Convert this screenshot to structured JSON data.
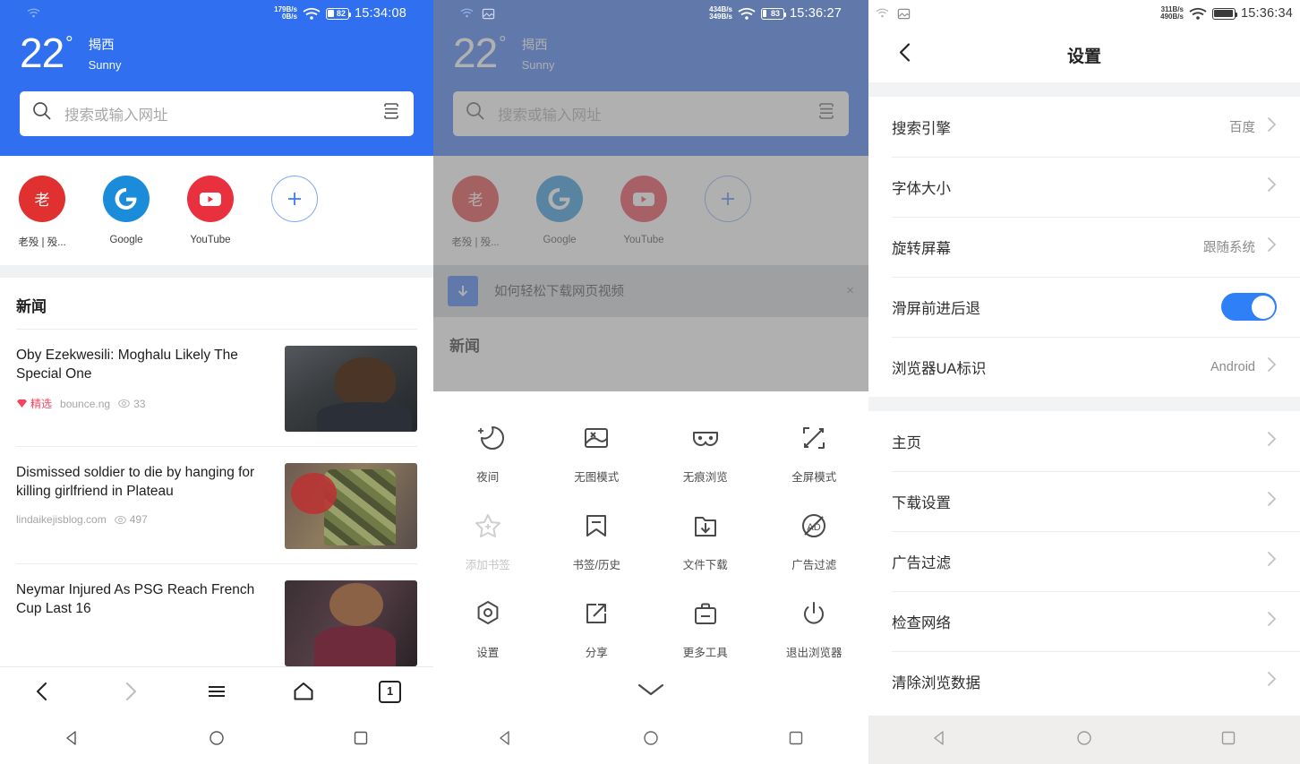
{
  "panel1": {
    "status": {
      "net_down": "179B/s",
      "net_up": "0B/s",
      "battery": "82",
      "time": "15:34:08"
    },
    "weather": {
      "temp": "22",
      "degree": "°",
      "city": "揭西",
      "condition": "Sunny"
    },
    "search": {
      "placeholder": "搜索或输入网址"
    },
    "shortcuts": [
      {
        "label": "老殁 | 殁...",
        "glyph": "老",
        "type": "text-red"
      },
      {
        "label": "Google",
        "glyph": "G",
        "type": "google"
      },
      {
        "label": "YouTube",
        "glyph": "▶",
        "type": "youtube"
      },
      {
        "label": "",
        "glyph": "+",
        "type": "add"
      }
    ],
    "news_heading": "新闻",
    "articles": [
      {
        "title": "Oby Ezekwesili: Moghalu Likely The Special One",
        "badge": "精选",
        "source": "bounce.ng",
        "views": "33",
        "thumb": "th1"
      },
      {
        "title": "Dismissed soldier to die by hanging for killing girlfriend in Plateau",
        "badge": "",
        "source": "lindaikejisblog.com",
        "views": "497",
        "thumb": "th2"
      },
      {
        "title": "Neymar Injured As PSG Reach French Cup Last 16",
        "badge": "",
        "source": "",
        "views": "",
        "thumb": "th3"
      }
    ],
    "toolbar": {
      "back": "back-arrow",
      "forward": "forward-arrow",
      "menu": "hamburger",
      "home": "home",
      "tabs": "1"
    }
  },
  "panel2": {
    "status": {
      "net_down": "434B/s",
      "net_up": "349B/s",
      "battery": "83",
      "time": "15:36:27"
    },
    "weather": {
      "temp": "22",
      "degree": "°",
      "city": "揭西",
      "condition": "Sunny"
    },
    "search": {
      "placeholder": "搜索或输入网址"
    },
    "shortcuts": [
      {
        "label": "老殁 | 殁...",
        "glyph": "老",
        "type": "text-red"
      },
      {
        "label": "Google",
        "glyph": "G",
        "type": "google"
      },
      {
        "label": "YouTube",
        "glyph": "▶",
        "type": "youtube"
      },
      {
        "label": "",
        "glyph": "+",
        "type": "add"
      }
    ],
    "banner": {
      "text": "如何轻松下载网页视频",
      "close": "×"
    },
    "news_heading": "新闻",
    "menu_items": [
      {
        "label": "夜间",
        "icon": "moon-icon",
        "disabled": false
      },
      {
        "label": "无图模式",
        "icon": "no-image-icon",
        "disabled": false
      },
      {
        "label": "无痕浏览",
        "icon": "incognito-mask-icon",
        "disabled": false
      },
      {
        "label": "全屏模式",
        "icon": "fullscreen-icon",
        "disabled": false
      },
      {
        "label": "添加书签",
        "icon": "add-bookmark-star-icon",
        "disabled": true
      },
      {
        "label": "书签/历史",
        "icon": "bookmark-icon",
        "disabled": false
      },
      {
        "label": "文件下载",
        "icon": "download-folder-icon",
        "disabled": false
      },
      {
        "label": "广告过滤",
        "icon": "ad-block-icon",
        "disabled": false
      },
      {
        "label": "设置",
        "icon": "settings-gear-icon",
        "disabled": false
      },
      {
        "label": "分享",
        "icon": "share-icon",
        "disabled": false
      },
      {
        "label": "更多工具",
        "icon": "toolbox-icon",
        "disabled": false
      },
      {
        "label": "退出浏览器",
        "icon": "power-icon",
        "disabled": false
      }
    ],
    "collapse": "chevron-down-icon"
  },
  "panel3": {
    "status": {
      "net_down": "311B/s",
      "net_up": "490B/s",
      "battery": "",
      "time": "15:36:34"
    },
    "title": "设置",
    "back": "back-chevron",
    "group1": [
      {
        "label": "搜索引擎",
        "value": "百度",
        "control": "chevron"
      },
      {
        "label": "字体大小",
        "value": "",
        "control": "chevron"
      },
      {
        "label": "旋转屏幕",
        "value": "跟随系统",
        "control": "chevron"
      },
      {
        "label": "滑屏前进后退",
        "value": "",
        "control": "toggle-on"
      },
      {
        "label": "浏览器UA标识",
        "value": "Android",
        "control": "chevron"
      }
    ],
    "group2": [
      {
        "label": "主页",
        "value": "",
        "control": "chevron"
      },
      {
        "label": "下载设置",
        "value": "",
        "control": "chevron"
      },
      {
        "label": "广告过滤",
        "value": "",
        "control": "chevron"
      },
      {
        "label": "检查网络",
        "value": "",
        "control": "chevron"
      },
      {
        "label": "清除浏览数据",
        "value": "",
        "control": "chevron"
      }
    ]
  },
  "colors": {
    "header_blue": "#2f6ff0",
    "accent": "#2f80f7",
    "badge_red": "#f5455e",
    "youtube_red": "#e8303e"
  }
}
